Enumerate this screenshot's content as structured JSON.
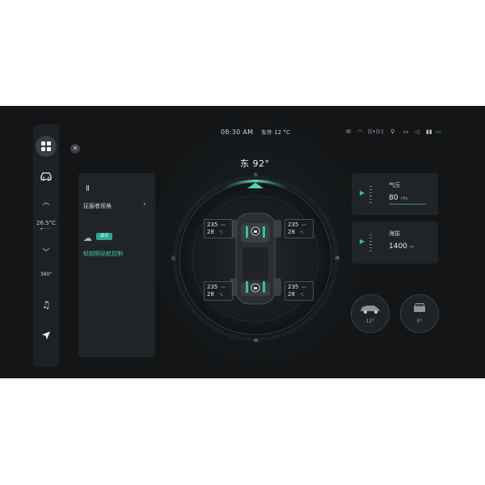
{
  "status_bar": {
    "time": "08:30 AM",
    "outside_temp": "车外 12 °C",
    "icons": [
      "mail-icon",
      "wifi-icon",
      "signal-icon",
      "bluetooth-icon",
      "location-icon",
      "camera-icon",
      "speaker-icon",
      "battery-icon"
    ]
  },
  "sidebar": {
    "temp": "26.5°C",
    "items": [
      "home-grid",
      "car",
      "up",
      "temperature",
      "down",
      "360-view",
      "music",
      "navigation"
    ],
    "view_label": "360°"
  },
  "left_panel": {
    "icon": "Ⅱ",
    "row_label": "征服者视角",
    "badge": "激活",
    "mode_label": "轻越野巡航控制"
  },
  "compass": {
    "heading": "东 92°",
    "north": "北",
    "east": "东",
    "south": "南",
    "west": "西"
  },
  "tires": {
    "front_left": {
      "pressure": "235",
      "pressure_unit": "kpa",
      "temp": "28",
      "temp_unit": "°C"
    },
    "front_right": {
      "pressure": "235",
      "pressure_unit": "kpa",
      "temp": "28",
      "temp_unit": "°C"
    },
    "rear_left": {
      "pressure": "235",
      "pressure_unit": "kpa",
      "temp": "28",
      "temp_unit": "°C"
    },
    "rear_right": {
      "pressure": "235",
      "pressure_unit": "kpa",
      "temp": "28",
      "temp_unit": "°C"
    }
  },
  "pressure_card": {
    "label": "气压",
    "value": "80",
    "unit": "hPa"
  },
  "altitude_card": {
    "label": "海拔",
    "value": "1400",
    "unit": "m"
  },
  "tilt": {
    "side_angle": "12°",
    "front_angle": "0°"
  },
  "colors": {
    "accent": "#34c29f",
    "background": "#131517",
    "panel": "#202427"
  }
}
